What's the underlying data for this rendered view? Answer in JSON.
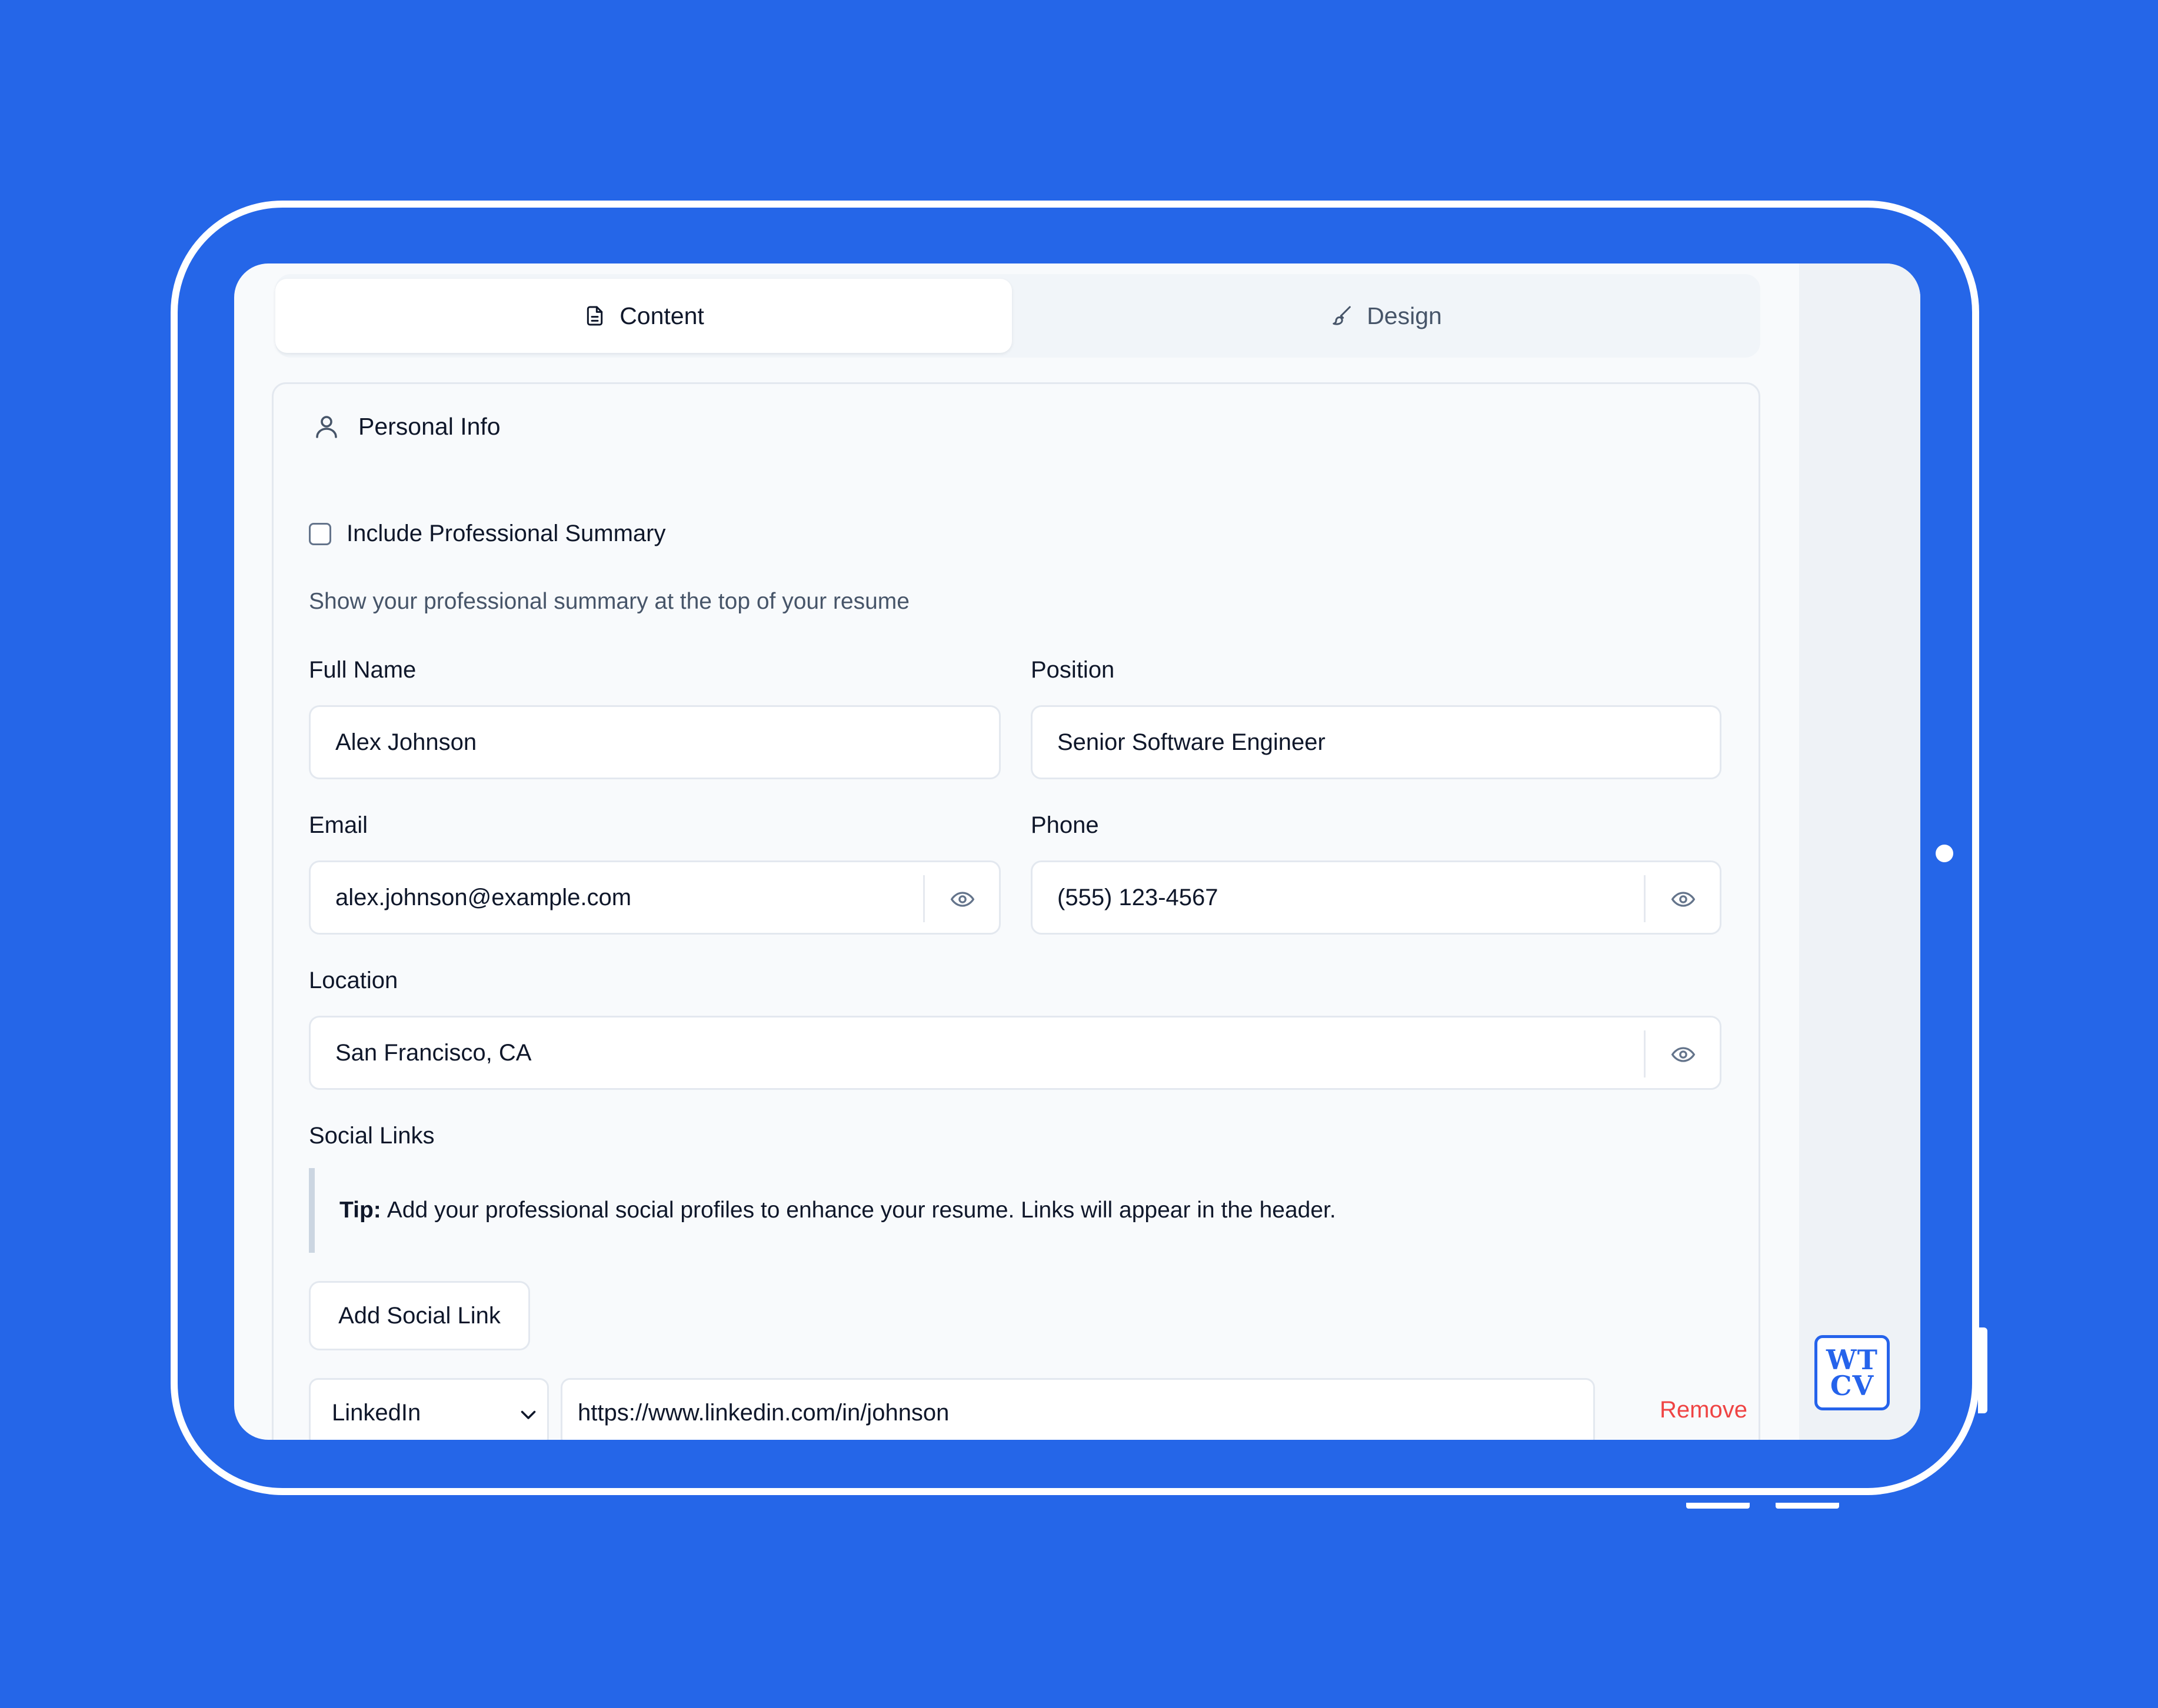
{
  "tabs": [
    {
      "label": "Content",
      "icon": "document-icon",
      "active": true
    },
    {
      "label": "Design",
      "icon": "brush-icon",
      "active": false
    }
  ],
  "section": {
    "title": "Personal Info",
    "icon": "user-icon"
  },
  "summary": {
    "checkbox_label": "Include Professional Summary",
    "checked": false,
    "description": "Show your professional summary at the top of your resume"
  },
  "fields": {
    "full_name": {
      "label": "Full Name",
      "value": "Alex Johnson"
    },
    "position": {
      "label": "Position",
      "value": "Senior Software Engineer"
    },
    "email": {
      "label": "Email",
      "value": "alex.johnson@example.com"
    },
    "phone": {
      "label": "Phone",
      "value": "(555) 123-4567"
    },
    "location": {
      "label": "Location",
      "value": "San Francisco, CA"
    }
  },
  "social": {
    "label": "Social Links",
    "tip_bold": "Tip:",
    "tip_text": "Add your professional social profiles to enhance your resume. Links will appear in the header.",
    "add_button": "Add Social Link",
    "links": [
      {
        "platform": "LinkedIn",
        "url": "https://www.linkedin.com/in/johnson",
        "remove_label": "Remove"
      }
    ]
  },
  "logo": {
    "line1": "WT",
    "line2": "CV",
    "color": "#2563eb"
  },
  "colors": {
    "background": "#2566e8",
    "accent": "#2563eb",
    "danger": "#ef4444"
  }
}
